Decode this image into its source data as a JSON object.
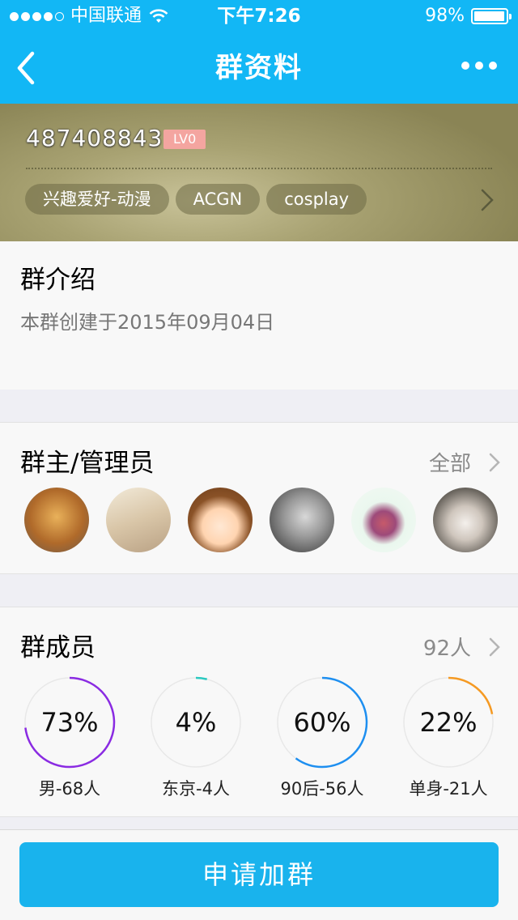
{
  "status_bar": {
    "carrier": "中国联通",
    "time": "下午7:26",
    "battery": "98%",
    "battery_level": 0.98,
    "signal_bars": 4
  },
  "nav": {
    "title": "群资料"
  },
  "group": {
    "id": "487408843",
    "level": "LV0",
    "tags": [
      "兴趣爱好-动漫",
      "ACGN",
      "cosplay"
    ]
  },
  "intro": {
    "title": "群介绍",
    "text": "本群创建于2015年09月04日"
  },
  "admins": {
    "title": "群主/管理员",
    "all_label": "全部",
    "avatars": [
      "lion-avatar",
      "girl-street-avatar",
      "anime-girl-avatar",
      "man-portrait-avatar",
      "figure-avatar",
      "cat-avatar"
    ]
  },
  "members": {
    "title": "群成员",
    "count": "92人",
    "stats": [
      {
        "percent": "73%",
        "value": 0.73,
        "label": "男-68人",
        "color": "#8a2be2"
      },
      {
        "percent": "4%",
        "value": 0.04,
        "label": "东京-4人",
        "color": "#2bc9c0"
      },
      {
        "percent": "60%",
        "value": 0.6,
        "label": "90后-56人",
        "color": "#1e8ff0"
      },
      {
        "percent": "22%",
        "value": 0.22,
        "label": "单身-21人",
        "color": "#f59a23"
      }
    ]
  },
  "footer": {
    "join_label": "申请加群"
  }
}
